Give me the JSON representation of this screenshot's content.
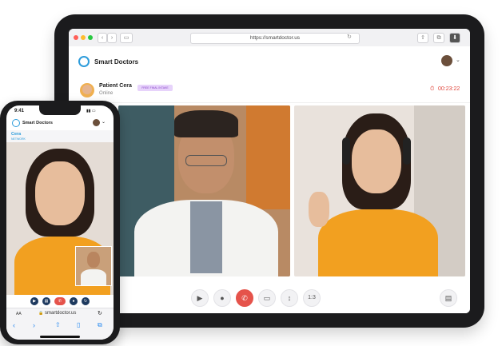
{
  "tablet": {
    "browser": {
      "url": "https://smartdoctor.us",
      "reload_icon": "reload-icon"
    },
    "app": {
      "brand_name": "Smart Doctors",
      "patient_name": "Patient Cera",
      "patient_status": "Online",
      "badge": "FREE FINAL INTAKE",
      "timer": "00:23:22"
    },
    "controls": {
      "camera_icon": "video-camera-icon",
      "mic_icon": "microphone-icon",
      "end_call_icon": "end-call-icon",
      "screen_icon": "screen-share-icon",
      "layout_icon": "resize-icon",
      "ratio_label": "1:3",
      "chat_icon": "chat-icon"
    }
  },
  "phone": {
    "status_time": "9:41",
    "brand_name": "Smart Doctors",
    "patient_name": "Cera",
    "patient_status": "NETWORK",
    "url": "smartdoctor.us",
    "aa_label": "AA"
  },
  "colors": {
    "accent": "#2d9cdb",
    "end_call": "#e5534b",
    "timer": "#e0473d",
    "badge_bg": "#e7d3fb",
    "badge_text": "#8a46c9",
    "shirt_orange": "#f2a020"
  }
}
